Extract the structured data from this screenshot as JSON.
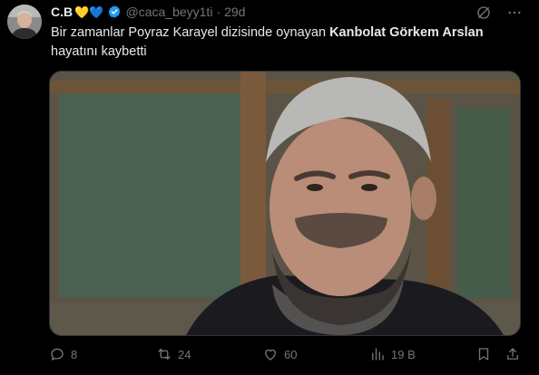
{
  "author": {
    "name": "C.B",
    "emojis": "💛💙",
    "handle": "@caca_beyy1ti",
    "separator": "·",
    "time": "29d"
  },
  "tweet": {
    "text_before": "Bir zamanlar Poyraz Karayel dizisinde oynayan ",
    "text_bold": "Kanbolat Görkem Arslan",
    "text_after": " hayatını kaybetti"
  },
  "actions": {
    "replies": "8",
    "reposts": "24",
    "likes": "60",
    "views": "19 B"
  },
  "colors": {
    "background": "#000000",
    "text": "#e7e9ea",
    "muted": "#71767b",
    "verified": "#1d9bf0"
  },
  "icons": {
    "header": [
      "grok-icon",
      "more-icon"
    ],
    "actions": [
      "reply-icon",
      "repost-icon",
      "like-icon",
      "views-icon",
      "bookmark-icon",
      "share-icon"
    ]
  }
}
